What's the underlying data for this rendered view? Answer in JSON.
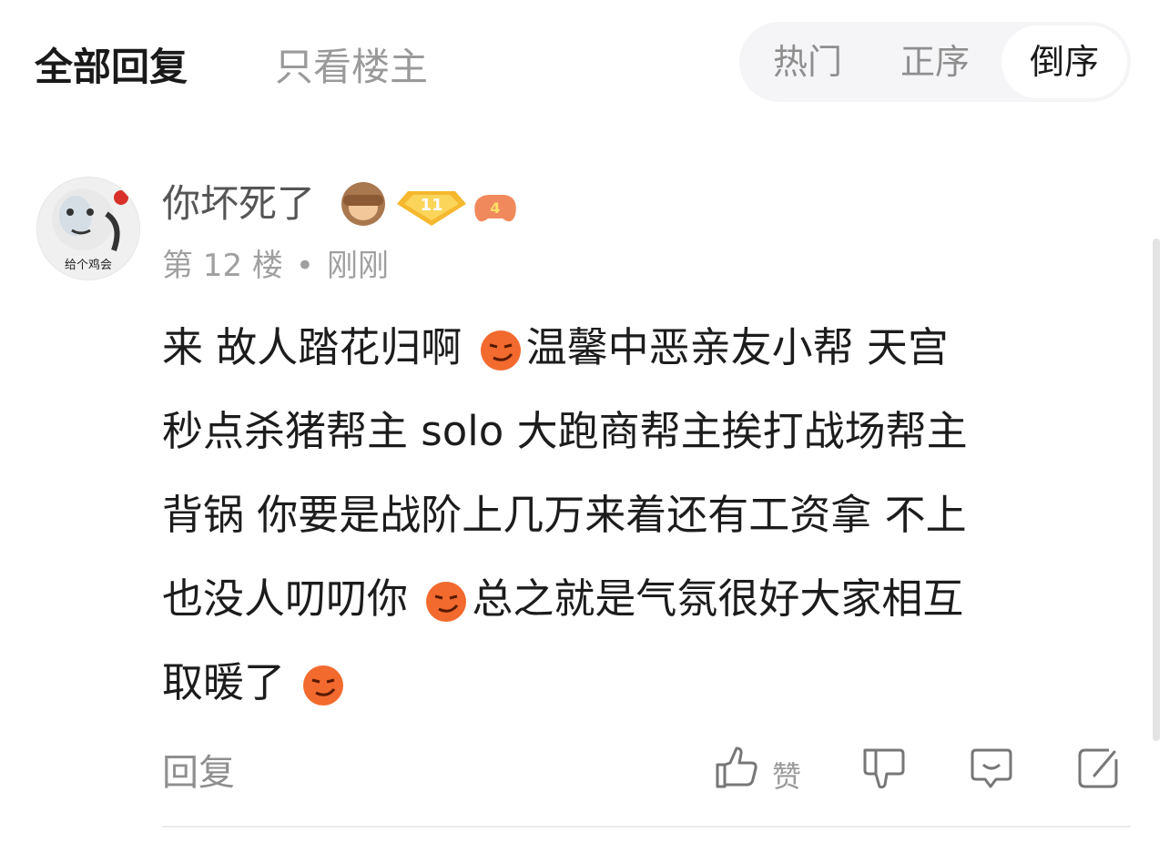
{
  "tabs": {
    "all": "全部回复",
    "owner_only": "只看楼主"
  },
  "sort": {
    "hot": "热门",
    "asc": "正序",
    "desc": "倒序",
    "selected": "倒序"
  },
  "comment": {
    "avatar_caption": "给个鸡会",
    "username": "你坏死了",
    "level_badge": "11",
    "game_badge": "4",
    "floor": "第 12 楼",
    "separator": "•",
    "time": "刚刚",
    "lines": [
      "来 故人踏花归啊",
      "温馨中恶亲友小帮 天宫",
      "秒点杀猪帮主 solo 大跑商帮主挨打战场帮主",
      "背锅 你要是战阶上几万来着还有工资拿 不上",
      "也没人叨叨你",
      "总之就是气氛很好大家相互",
      "取暖了"
    ]
  },
  "actions": {
    "reply": "回复",
    "like": "赞"
  },
  "colors": {
    "accent_badge": "#f5b82e",
    "emoji": "#f26a2e"
  },
  "icons": [
    "see-no-evil-monkey-icon",
    "level-badge-icon",
    "game-badge-icon",
    "smirk-emoji-icon",
    "like-icon",
    "dislike-icon",
    "comment-icon",
    "edit-icon"
  ]
}
